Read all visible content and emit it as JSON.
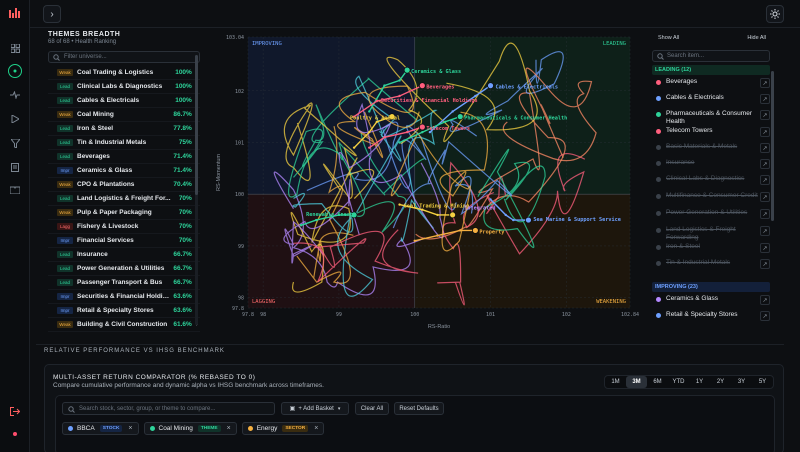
{
  "header": {
    "collapse_icon": "chevron-right-icon",
    "theme_icon": "sun-icon"
  },
  "rail": {
    "icons": [
      "grid-icon",
      "compass-icon",
      "activity-icon",
      "play-icon",
      "filter-icon",
      "document-icon",
      "book-icon",
      "logout-icon"
    ]
  },
  "breadth": {
    "title": "THEMES BREADTH",
    "subtitle": "68 of 68 • Health Ranking",
    "filter_placeholder": "Filter universe...",
    "rows": [
      {
        "status": "Weak",
        "name": "Coal Trading & Logistics",
        "pct": "100%"
      },
      {
        "status": "Lead",
        "name": "Clinical Labs & Diagnostics",
        "pct": "100%"
      },
      {
        "status": "Lead",
        "name": "Cables & Electricals",
        "pct": "100%"
      },
      {
        "status": "Weak",
        "name": "Coal Mining",
        "pct": "86.7%"
      },
      {
        "status": "Lead",
        "name": "Iron & Steel",
        "pct": "77.8%"
      },
      {
        "status": "Lead",
        "name": "Tin & Industrial Metals",
        "pct": "75%"
      },
      {
        "status": "Lead",
        "name": "Beverages",
        "pct": "71.4%"
      },
      {
        "status": "Impr",
        "name": "Ceramics & Glass",
        "pct": "71.4%"
      },
      {
        "status": "Weak",
        "name": "CPO & Plantations",
        "pct": "70.4%"
      },
      {
        "status": "Lead",
        "name": "Land Logistics & Freight For...",
        "pct": "70%"
      },
      {
        "status": "Weak",
        "name": "Pulp & Paper Packaging",
        "pct": "70%"
      },
      {
        "status": "Lagg",
        "name": "Fishery & Livestock",
        "pct": "70%"
      },
      {
        "status": "Impr",
        "name": "Financial Services",
        "pct": "70%"
      },
      {
        "status": "Lead",
        "name": "Insurance",
        "pct": "66.7%"
      },
      {
        "status": "Lead",
        "name": "Power Generation & Utilities",
        "pct": "66.7%"
      },
      {
        "status": "Lead",
        "name": "Passenger Transport & Bus",
        "pct": "66.7%"
      },
      {
        "status": "Impr",
        "name": "Securities & Financial Holdin...",
        "pct": "63.6%"
      },
      {
        "status": "Impr",
        "name": "Retail & Specialty Stores",
        "pct": "63.6%"
      },
      {
        "status": "Weak",
        "name": "Building & Civil Construction",
        "pct": "61.6%"
      }
    ]
  },
  "rrg": {
    "quadrants": {
      "improving": "IMPROVING",
      "leading": "LEADING",
      "lagging": "LAGGING",
      "weakening": "WEAKENING"
    },
    "xlabel": "RS-Ratio",
    "ylabel": "RS-Momentum",
    "x_ticks": [
      "97.8",
      "98",
      "99",
      "100",
      "101",
      "102",
      "102.84"
    ],
    "y_ticks": [
      "103.04",
      "102",
      "101",
      "100",
      "99",
      "98",
      "97.8"
    ],
    "labels": [
      {
        "text": "Ceramics & Glass",
        "color": "#2ed39a"
      },
      {
        "text": "Beverages",
        "color": "#ff5f7e"
      },
      {
        "text": "Cables & Electricals",
        "color": "#6ea0ff"
      },
      {
        "text": "Securities & Financial Holdings",
        "color": "#ff5f7e"
      },
      {
        "text": "Poultry & Animal",
        "color": "#f5d142"
      },
      {
        "text": "Pharmaceuticals & Consumer Health",
        "color": "#2ed39a"
      },
      {
        "text": "Telecom Towers",
        "color": "#ff5f7e"
      },
      {
        "text": "Renewable Energy",
        "color": "#2ed39a"
      },
      {
        "text": "Coal Trading & Mining",
        "color": "#f5d142"
      },
      {
        "text": "Integrated",
        "color": "#b388ff"
      },
      {
        "text": "Sea Marine & Support Service",
        "color": "#6ea0ff"
      },
      {
        "text": "Property",
        "color": "#f5b041"
      }
    ]
  },
  "chart_data": {
    "type": "scatter",
    "xlabel": "RS-Ratio",
    "ylabel": "RS-Momentum",
    "xlim": [
      97.8,
      102.84
    ],
    "ylim": [
      97.8,
      103.04
    ],
    "series": [
      {
        "name": "Ceramics & Glass",
        "x": [
          99.4,
          99.6,
          99.8,
          99.9
        ],
        "y": [
          101.6,
          102.1,
          102.2,
          102.4
        ],
        "color": "#2ed39a"
      },
      {
        "name": "Beverages",
        "x": [
          99.2,
          99.5,
          99.8,
          100.1
        ],
        "y": [
          101.5,
          101.8,
          101.9,
          102.1
        ],
        "color": "#ff5f7e"
      },
      {
        "name": "Cables & Electricals",
        "x": [
          100.2,
          100.5,
          100.8,
          101.0
        ],
        "y": [
          101.2,
          101.6,
          101.9,
          102.1
        ],
        "color": "#6ea0ff"
      },
      {
        "name": "Poultry & Animal",
        "x": [
          99.2,
          99.4,
          99.5,
          99.7
        ],
        "y": [
          100.9,
          101.2,
          101.4,
          101.5
        ],
        "color": "#f5d142"
      },
      {
        "name": "Pharmaceuticals & Consumer Health",
        "x": [
          99.8,
          100.1,
          100.4,
          100.6
        ],
        "y": [
          101.0,
          101.2,
          101.4,
          101.5
        ],
        "color": "#2ed39a"
      },
      {
        "name": "Telecom Towers",
        "x": [
          99.4,
          99.6,
          99.9,
          100.1
        ],
        "y": [
          100.9,
          101.1,
          101.2,
          101.3
        ],
        "color": "#ff5f7e"
      },
      {
        "name": "Renewable Energy",
        "x": [
          98.5,
          98.7,
          99.0,
          99.2
        ],
        "y": [
          99.4,
          99.5,
          99.6,
          99.6
        ],
        "color": "#2ed39a"
      },
      {
        "name": "Coal Trading & Mining",
        "x": [
          99.8,
          100.1,
          100.3,
          100.5
        ],
        "y": [
          99.8,
          99.7,
          99.6,
          99.6
        ],
        "color": "#f5d142"
      },
      {
        "name": "Sea Marine & Support Service",
        "x": [
          101.0,
          101.2,
          101.3,
          101.5
        ],
        "y": [
          99.9,
          99.6,
          99.5,
          99.5
        ],
        "color": "#6ea0ff"
      },
      {
        "name": "Property",
        "x": [
          100.0,
          100.3,
          100.6,
          100.8
        ],
        "y": [
          99.1,
          99.2,
          99.3,
          99.3
        ],
        "color": "#f5b041"
      }
    ]
  },
  "watch": {
    "show_all": "Show All",
    "hide_all": "Hide All",
    "search_placeholder": "Search item...",
    "section_leading": "LEADING (12)",
    "section_improving": "IMPROVING (23)",
    "leading_items": [
      {
        "name": "Beverages",
        "color": "#ff5f7e",
        "on": true
      },
      {
        "name": "Cables & Electricals",
        "color": "#6ea0ff",
        "on": true
      },
      {
        "name": "Pharmaceuticals & Consumer Health",
        "color": "#2ed39a",
        "on": true
      },
      {
        "name": "Telecom Towers",
        "color": "#ff5f7e",
        "on": true
      },
      {
        "name": "Basic Materials & Metals",
        "color": "#4c545e",
        "on": false
      },
      {
        "name": "Insurance",
        "color": "#4c545e",
        "on": false
      },
      {
        "name": "Clinical Labs & Diagnostics",
        "color": "#4c545e",
        "on": false
      },
      {
        "name": "Multifinance & Consumer Credit",
        "color": "#4c545e",
        "on": false
      },
      {
        "name": "Power Generation & Utilities",
        "color": "#4c545e",
        "on": false
      },
      {
        "name": "Land Logistics & Freight Forwarding",
        "color": "#4c545e",
        "on": false
      },
      {
        "name": "Iron & Steel",
        "color": "#4c545e",
        "on": false
      },
      {
        "name": "Tin & Industrial Metals",
        "color": "#4c545e",
        "on": false
      }
    ],
    "improving_items": [
      {
        "name": "Ceramics & Glass",
        "color": "#b388ff",
        "on": true
      },
      {
        "name": "Retail & Specialty Stores",
        "color": "#6ea0ff",
        "on": true
      }
    ]
  },
  "benchmark": {
    "section_title": "RELATIVE PERFORMANCE VS IHSG BENCHMARK",
    "title": "MULTI-ASSET RETURN COMPARATOR (% REBASED TO 0)",
    "subtitle": "Compare cumulative performance and dynamic alpha vs IHSG benchmark across timeframes.",
    "timeframes": [
      "1M",
      "3M",
      "6M",
      "YTD",
      "1Y",
      "2Y",
      "3Y",
      "5Y"
    ],
    "active_timeframe": "3M",
    "search_placeholder": "Search stock, sector, group, or theme to compare...",
    "add_basket": "+ Add Basket",
    "clear_all": "Clear All",
    "reset_defaults": "Reset Defaults",
    "chips": [
      {
        "name": "BBCA",
        "type": "STOCK",
        "color": "#6ea0ff",
        "tag_bg": "#152544",
        "tag_fg": "#6ea0ff"
      },
      {
        "name": "Coal Mining",
        "type": "THEME",
        "color": "#2ed39a",
        "tag_bg": "#10332a",
        "tag_fg": "#2ed39a"
      },
      {
        "name": "Energy",
        "type": "SECTOR",
        "color": "#f5b041",
        "tag_bg": "#3a2c10",
        "tag_fg": "#f5b041"
      }
    ]
  }
}
